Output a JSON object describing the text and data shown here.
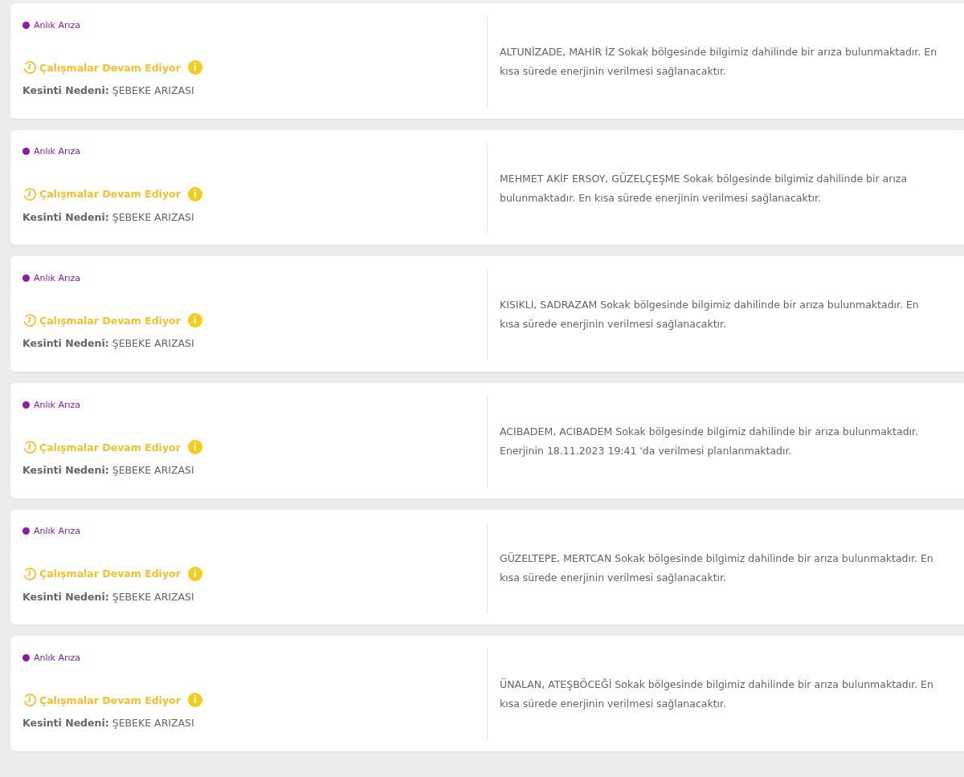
{
  "outages": [
    {
      "tag": "Anlık Arıza",
      "color": "#8b1aa8",
      "status": "Çalışmalar Devam Ediyor",
      "info": "i",
      "reason_label": "Kesinti Nedeni:",
      "reason": "ŞEBEKE ARIZASI",
      "message": "ALTUNİZADE, MAHİR İZ Sokak bölgesinde bilgimiz dahilinde bir arıza bulunmaktadır. En kısa sürede enerjinin verilmesi sağlanacaktır."
    },
    {
      "tag": "Anlık Arıza",
      "color": "#8b1aa8",
      "status": "Çalışmalar Devam Ediyor",
      "info": "i",
      "reason_label": "Kesinti Nedeni:",
      "reason": "ŞEBEKE ARIZASI",
      "message": "MEHMET AKİF ERSOY, GÜZELÇEŞME Sokak bölgesinde bilgimiz dahilinde bir arıza bulunmaktadır. En kısa sürede enerjinin verilmesi sağlanacaktır."
    },
    {
      "tag": "Anlık Arıza",
      "color": "#8b1aa8",
      "status": "Çalışmalar Devam Ediyor",
      "info": "i",
      "reason_label": "Kesinti Nedeni:",
      "reason": "ŞEBEKE ARIZASI",
      "message": "KISIKLI, SADRAZAM Sokak bölgesinde bilgimiz dahilinde bir arıza bulunmaktadır. En kısa sürede enerjinin verilmesi sağlanacaktır."
    },
    {
      "tag": "Anlık Arıza",
      "color": "#8b1aa8",
      "status": "Çalışmalar Devam Ediyor",
      "info": "i",
      "reason_label": "Kesinti Nedeni:",
      "reason": "ŞEBEKE ARIZASI",
      "message": "ACIBADEM, ACIBADEM Sokak bölgesinde bilgimiz dahilinde bir arıza bulunmaktadır. Enerjinin 18.11.2023 19:41 'da verilmesi planlanmaktadır."
    },
    {
      "tag": "Anlık Arıza",
      "color": "#8b1aa8",
      "status": "Çalışmalar Devam Ediyor",
      "info": "i",
      "reason_label": "Kesinti Nedeni:",
      "reason": "ŞEBEKE ARIZASI",
      "message": "GÜZELTEPE, MERTCAN Sokak bölgesinde bilgimiz dahilinde bir arıza bulunmaktadır. En kısa sürede enerjinin verilmesi sağlanacaktır."
    },
    {
      "tag": "Anlık Arıza",
      "color": "#8b1aa8",
      "status": "Çalışmalar Devam Ediyor",
      "info": "i",
      "reason_label": "Kesinti Nedeni:",
      "reason": "ŞEBEKE ARIZASI",
      "message": "ÜNALAN, ATEŞBÖCEĞİ Sokak bölgesinde bilgimiz dahilinde bir arıza bulunmaktadır. En kısa sürede enerjinin verilmesi sağlanacaktır."
    }
  ]
}
